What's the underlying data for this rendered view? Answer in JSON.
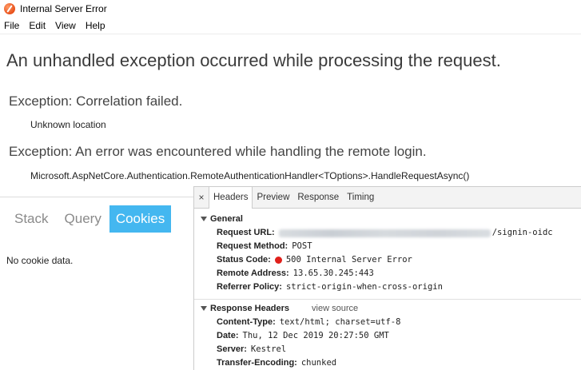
{
  "window": {
    "title": "Internal Server Error",
    "menu": [
      "File",
      "Edit",
      "View",
      "Help"
    ]
  },
  "page": {
    "heading": "An unhandled exception occurred while processing the request.",
    "exceptions": [
      {
        "title": "Exception: Correlation failed.",
        "detail": "Unknown location"
      },
      {
        "title": "Exception: An error was encountered while handling the remote login.",
        "detail": "Microsoft.AspNetCore.Authentication.RemoteAuthenticationHandler<TOptions>.HandleRequestAsync()"
      }
    ],
    "tabs": [
      "Stack",
      "Query",
      "Cookies"
    ],
    "active_tab": "Cookies",
    "cookie_text": "No cookie data."
  },
  "devtools": {
    "close": "×",
    "tabs": [
      "Headers",
      "Preview",
      "Response",
      "Timing"
    ],
    "active_tab": "Headers",
    "general": {
      "title": "General",
      "request_url_label": "Request URL:",
      "request_url_suffix": "/signin-oidc",
      "request_method_label": "Request Method:",
      "request_method": "POST",
      "status_code_label": "Status Code:",
      "status_code": "500 Internal Server Error",
      "remote_address_label": "Remote Address:",
      "remote_address": "13.65.30.245:443",
      "referrer_policy_label": "Referrer Policy:",
      "referrer_policy": "strict-origin-when-cross-origin"
    },
    "response_headers": {
      "title": "Response Headers",
      "view_source": "view source",
      "content_type_label": "Content-Type:",
      "content_type": "text/html; charset=utf-8",
      "date_label": "Date:",
      "date": "Thu, 12 Dec 2019 20:27:50 GMT",
      "server_label": "Server:",
      "server": "Kestrel",
      "transfer_encoding_label": "Transfer-Encoding:",
      "transfer_encoding": "chunked"
    }
  },
  "colors": {
    "active_tab_bg": "#44b7f0",
    "status_error": "#e0201b"
  }
}
